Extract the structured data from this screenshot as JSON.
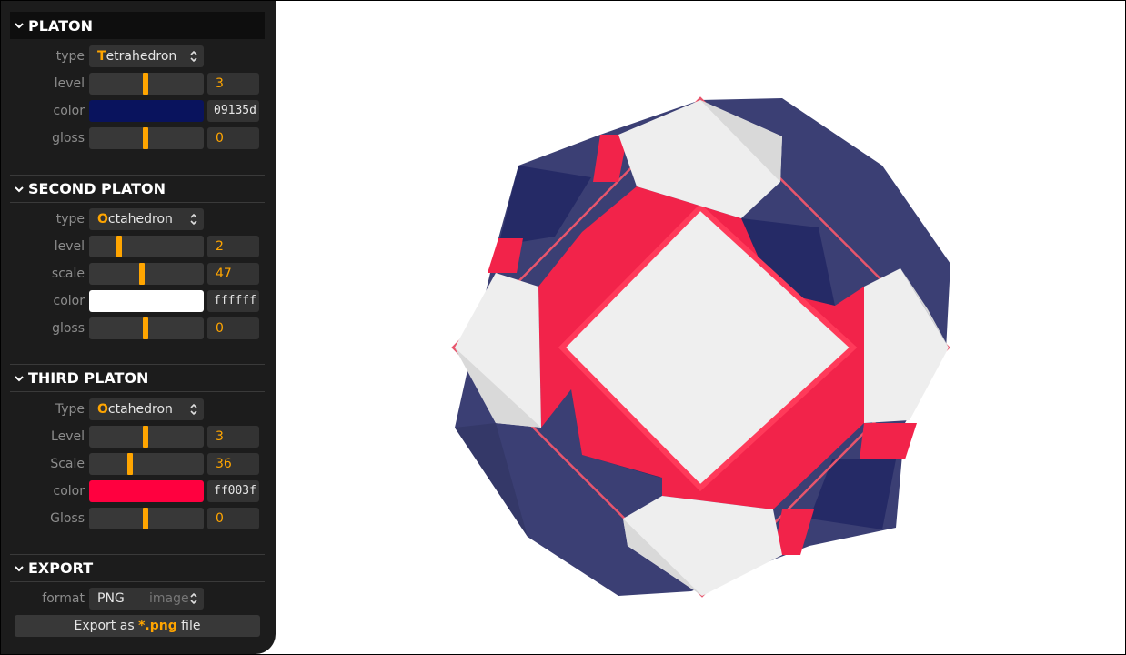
{
  "sections": {
    "platon": {
      "title": "PLATON",
      "type_label": "type",
      "type_value_first": "T",
      "type_value_rest": "etrahedron",
      "level_label": "level",
      "level_value": "3",
      "color_label": "color",
      "color_hex": "09135d",
      "color_swatch": "#09135d",
      "gloss_label": "gloss",
      "gloss_value": "0"
    },
    "second": {
      "title": "SECOND PLATON",
      "type_label": "type",
      "type_value_first": "O",
      "type_value_rest": "ctahedron",
      "level_label": "level",
      "level_value": "2",
      "scale_label": "scale",
      "scale_value": "47",
      "color_label": "color",
      "color_hex": "ffffff",
      "color_swatch": "#ffffff",
      "gloss_label": "gloss",
      "gloss_value": "0"
    },
    "third": {
      "title": "THIRD PLATON",
      "type_label": "Type",
      "type_value_first": "O",
      "type_value_rest": "ctahedron",
      "level_label": "Level",
      "level_value": "3",
      "scale_label": "Scale",
      "scale_value": "36",
      "color_label": "color",
      "color_hex": "ff003f",
      "color_swatch": "#ff003f",
      "gloss_label": "Gloss",
      "gloss_value": "0"
    },
    "export": {
      "title": "EXPORT",
      "format_label": "format",
      "format_value": "PNG",
      "format_hint": "image",
      "button_prefix": "Export as ",
      "button_ext": "*.png",
      "button_suffix": " file"
    }
  },
  "colors": {
    "accent": "#ffa500",
    "panel_bg": "#1c1c1c",
    "control_bg": "#333333",
    "navy": "#3b3f74",
    "navy_dark": "#252a66",
    "red": "#f2234a",
    "white": "#f0f0f0"
  },
  "icons": {
    "section_toggle": "chevron-down-icon",
    "select_arrows": "updown-arrows-icon"
  }
}
